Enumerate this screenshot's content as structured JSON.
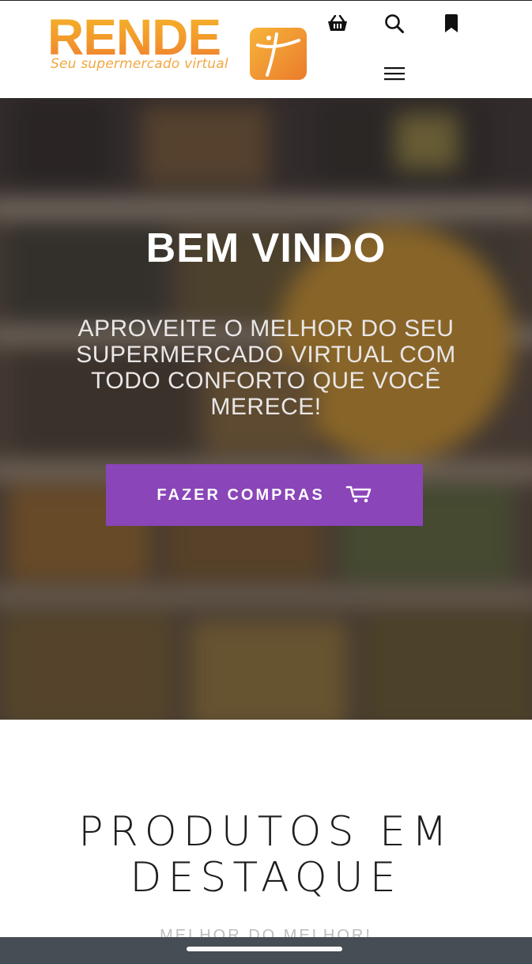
{
  "header": {
    "logo": {
      "name": "RENDE",
      "tagline": "Seu supermercado virtual"
    },
    "icons": [
      "basket-icon",
      "search-icon",
      "bookmark-icon",
      "hamburger-menu-icon"
    ]
  },
  "hero": {
    "title": "BEM VINDO",
    "subtitle": "APROVEITE O MELHOR DO SEU SUPERMERCADO VIRTUAL COM TODO CONFORTO QUE VOCÊ MERECE!",
    "cta_label": "FAZER COMPRAS",
    "cta_icon": "shopping-cart-icon"
  },
  "products": {
    "title": "PRODUTOS EM DESTAQUE",
    "subtitle": "MELHOR DO MELHOR!"
  },
  "colors": {
    "brand_orange": "#f39a2c",
    "cta_purple": "#8a45b8",
    "bottom_bar": "#474d54"
  }
}
